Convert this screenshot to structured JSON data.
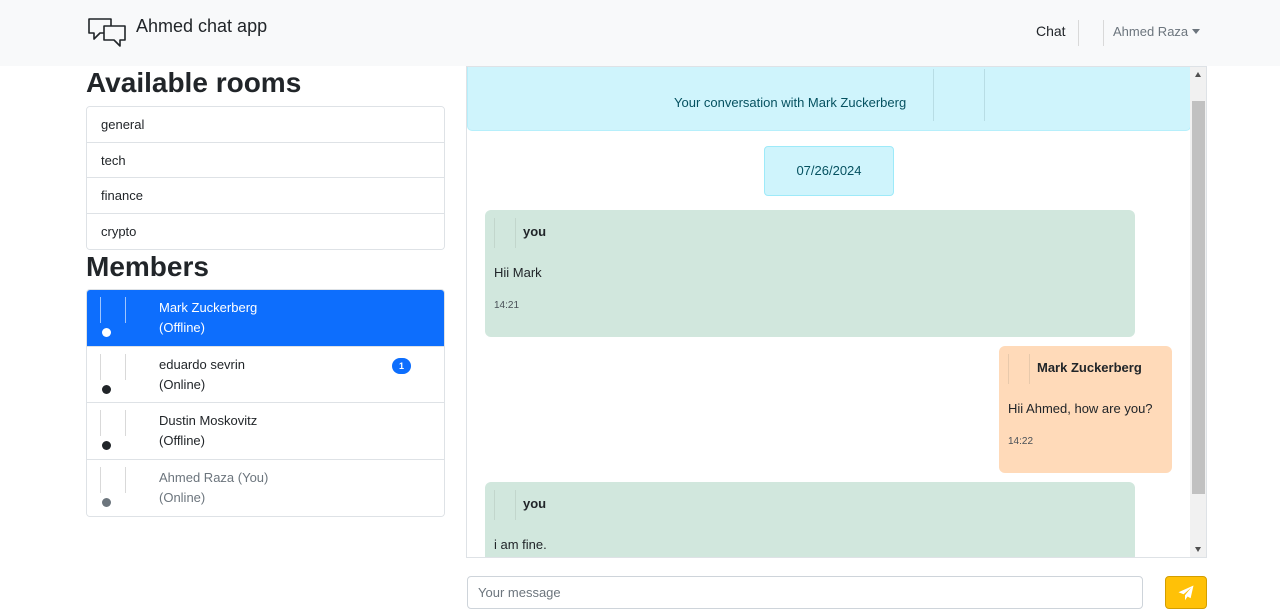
{
  "navbar": {
    "brand": "Ahmed chat app",
    "chat_link": "Chat",
    "user_menu": "Ahmed Raza"
  },
  "rooms": {
    "title": "Available rooms",
    "items": [
      "general",
      "tech",
      "finance",
      "crypto"
    ]
  },
  "members": {
    "title": "Members",
    "items": [
      {
        "name": "Mark Zuckerberg",
        "status": "(Offline)",
        "badge": ""
      },
      {
        "name": "eduardo sevrin",
        "status": "(Online)",
        "badge": "1"
      },
      {
        "name": "Dustin Moskovitz",
        "status": "(Offline)",
        "badge": ""
      },
      {
        "name": "Ahmed Raza (You)",
        "status": "(Online)",
        "badge": ""
      }
    ]
  },
  "conversation": {
    "header": "Your conversation with Mark Zuckerberg",
    "date": "07/26/2024",
    "messages": [
      {
        "sender": "you",
        "text": "Hii Mark",
        "time": "14:21"
      },
      {
        "sender": "Mark Zuckerberg",
        "text": "Hii Ahmed, how are you?",
        "time": "14:22"
      },
      {
        "sender": "you",
        "text": "i am fine.",
        "time": ""
      }
    ]
  },
  "composer": {
    "placeholder": "Your message"
  },
  "colors": {
    "active_member": "#0d6efd",
    "own_message": "#d1e7dd",
    "other_message": "#ffdab9",
    "send_button": "#ffc107",
    "info_bg": "#cff4fc"
  }
}
